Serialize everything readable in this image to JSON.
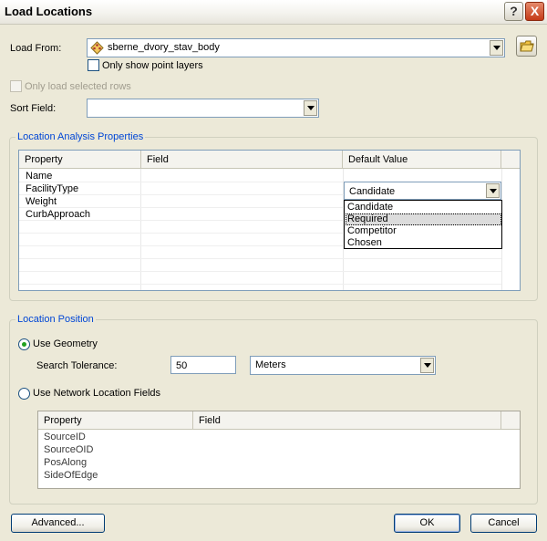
{
  "window": {
    "title": "Load Locations"
  },
  "title_buttons": {
    "help": "?",
    "close": "X"
  },
  "load_from": {
    "label": "Load From:",
    "value": "sberne_dvory_stav_body",
    "only_point_layers": "Only show point layers"
  },
  "only_selected_rows": "Only load selected rows",
  "sort_field": {
    "label": "Sort Field:",
    "value": ""
  },
  "location_analysis": {
    "legend": "Location Analysis Properties",
    "columns": [
      "Property",
      "Field",
      "Default Value"
    ],
    "rows": [
      "Name",
      "FacilityType",
      "Weight",
      "CurbApproach"
    ],
    "combo_value": "Candidate",
    "options": [
      "Candidate",
      "Required",
      "Competitor",
      "Chosen"
    ]
  },
  "location_position": {
    "legend": "Location Position",
    "use_geometry": "Use Geometry",
    "search_tolerance_label": "Search Tolerance:",
    "search_tolerance_value": "50",
    "units": "Meters",
    "use_network_fields": "Use Network Location Fields",
    "columns": [
      "Property",
      "Field"
    ],
    "rows": [
      "SourceID",
      "SourceOID",
      "PosAlong",
      "SideOfEdge"
    ]
  },
  "buttons": {
    "advanced": "Advanced...",
    "ok": "OK",
    "cancel": "Cancel"
  },
  "colors": {
    "legend": "#0046d5",
    "dialog_bg": "#ece9d8",
    "close_red": "#c53a17"
  }
}
